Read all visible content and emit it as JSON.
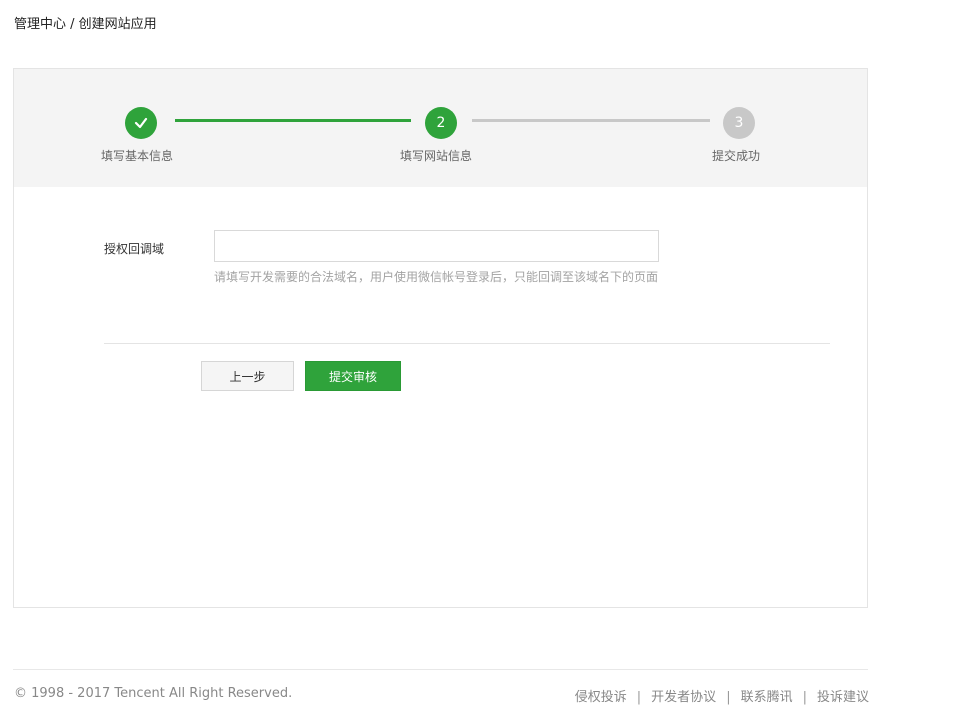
{
  "breadcrumb": "管理中心 / 创建网站应用",
  "steps": [
    {
      "label": "填写基本信息",
      "status": "done",
      "number": "1"
    },
    {
      "label": "填写网站信息",
      "status": "active",
      "number": "2"
    },
    {
      "label": "提交成功",
      "status": "pending",
      "number": "3"
    }
  ],
  "colors": {
    "accent": "#2fa33b",
    "pending": "#c8c8c8",
    "band": "#f4f4f4"
  },
  "form": {
    "callback_label": "授权回调域",
    "callback_value": "",
    "callback_placeholder": "",
    "hint": "请填写开发需要的合法域名，用户使用微信帐号登录后，只能回调至该域名下的页面"
  },
  "buttons": {
    "prev": "上一步",
    "submit": "提交审核"
  },
  "footer": {
    "copyright": "© 1998 - 2017 Tencent All Right Reserved.",
    "links": [
      "侵权投诉",
      "开发者协议",
      "联系腾讯",
      "投诉建议"
    ],
    "separator": "|"
  }
}
